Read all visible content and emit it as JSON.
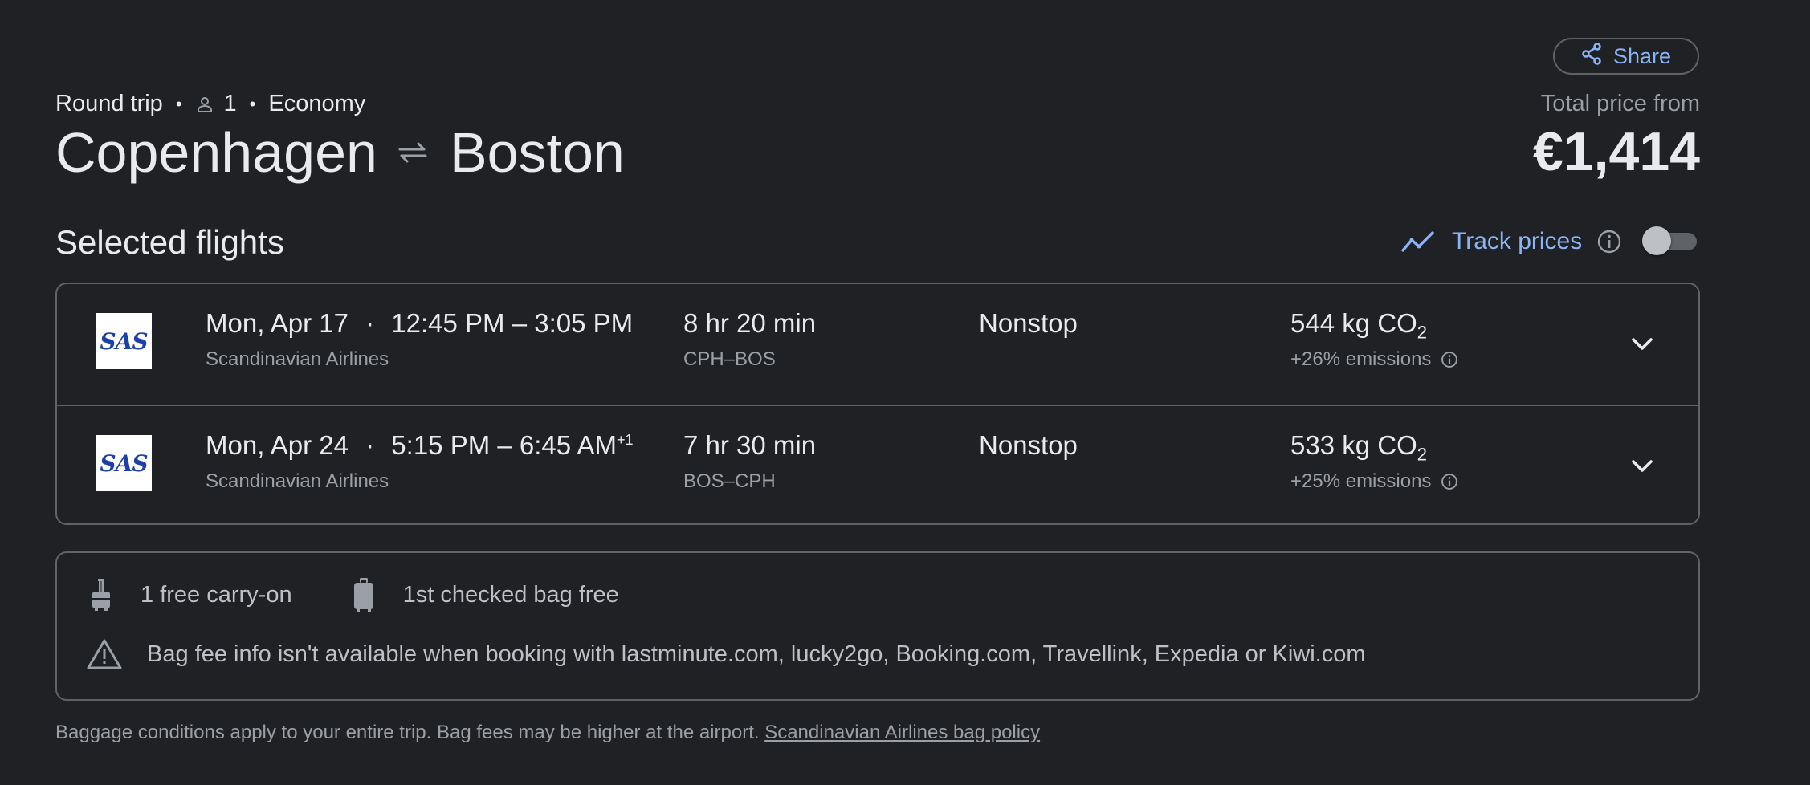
{
  "header": {
    "share_label": "Share",
    "trip_type": "Round trip",
    "passengers": "1",
    "cabin_class": "Economy",
    "origin": "Copenhagen",
    "destination": "Boston",
    "price_label": "Total price from",
    "price": "€1,414"
  },
  "selected": {
    "title": "Selected flights",
    "track_prices_label": "Track prices",
    "track_prices_on": false
  },
  "flights": [
    {
      "logo_text": "SAS",
      "date": "Mon, Apr 17",
      "time_range": "12:45 PM – 3:05 PM",
      "day_offset": "",
      "airline": "Scandinavian Airlines",
      "duration": "8 hr 20 min",
      "airports": "CPH–BOS",
      "stops": "Nonstop",
      "co2_amount": "544 kg CO",
      "co2_sub": "2",
      "emissions": "+26% emissions"
    },
    {
      "logo_text": "SAS",
      "date": "Mon, Apr 24",
      "time_range": "5:15 PM – 6:45 AM",
      "day_offset": "+1",
      "airline": "Scandinavian Airlines",
      "duration": "7 hr 30 min",
      "airports": "BOS–CPH",
      "stops": "Nonstop",
      "co2_amount": "533 kg CO",
      "co2_sub": "2",
      "emissions": "+25% emissions"
    }
  ],
  "baggage": {
    "carry_on": "1 free carry-on",
    "checked": "1st checked bag free",
    "warning": "Bag fee info isn't available when booking with lastminute.com, lucky2go, Booking.com, Travellink, Expedia or Kiwi.com"
  },
  "footer": {
    "text": "Baggage conditions apply to your entire trip. Bag fees may be higher at the airport.",
    "link": "Scandinavian Airlines bag policy"
  },
  "colors": {
    "background": "#202124",
    "accent": "#8ab4f8",
    "border": "#5f6368"
  }
}
